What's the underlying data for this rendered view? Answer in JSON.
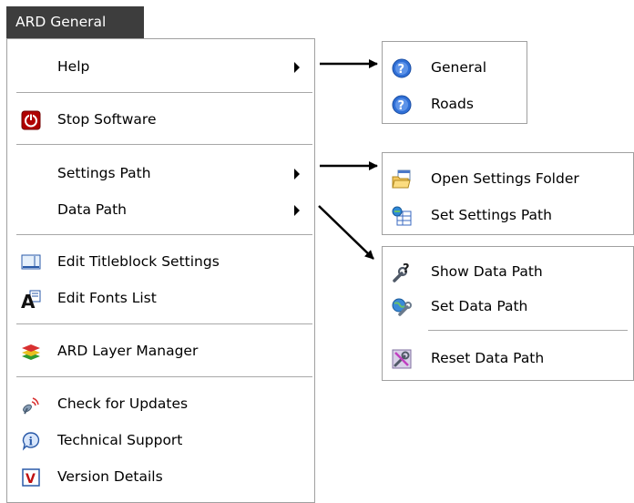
{
  "title": "ARD General",
  "menu": {
    "help": "Help",
    "stop_software": "Stop Software",
    "settings_path": "Settings Path",
    "data_path": "Data Path",
    "edit_titleblock": "Edit Titleblock Settings",
    "edit_fonts": "Edit Fonts List",
    "layer_manager": "ARD Layer Manager",
    "check_updates": "Check for Updates",
    "tech_support": "Technical Support",
    "version_details": "Version Details"
  },
  "help_submenu": {
    "general": "General",
    "roads": "Roads"
  },
  "settings_submenu": {
    "open_folder": "Open Settings Folder",
    "set_path": "Set Settings Path"
  },
  "data_submenu": {
    "show_path": "Show Data Path",
    "set_path": "Set Data Path",
    "reset_path": "Reset Data Path"
  },
  "colors": {
    "title_bg": "#3d3d3d",
    "arrow": "#000000",
    "stop_icon": "#b00000",
    "help_icon": "#2f6fd6"
  }
}
